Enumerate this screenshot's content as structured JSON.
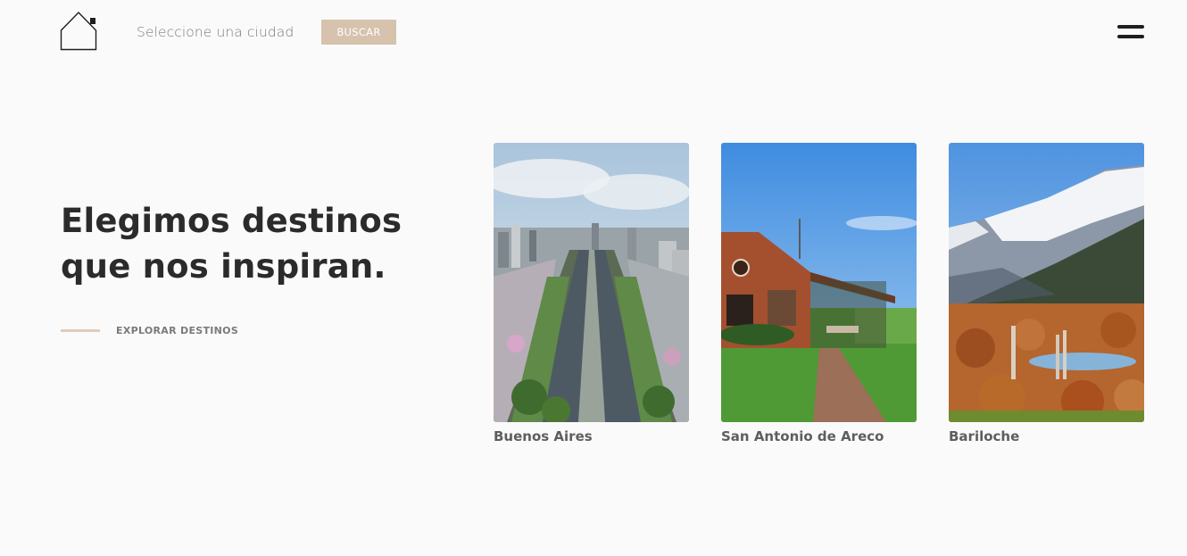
{
  "header": {
    "logo_icon": "house-outline-icon",
    "search": {
      "placeholder": "Seleccione una ciudad",
      "value": ""
    },
    "search_button_label": "BUSCAR",
    "menu_icon": "hamburger-menu-icon"
  },
  "hero": {
    "title_line1": "Elegimos destinos",
    "title_line2": "que nos inspiran.",
    "explore_label": "EXPLORAR DESTINOS"
  },
  "destinations": [
    {
      "name": "Buenos Aires",
      "image": "city-avenue-photo"
    },
    {
      "name": "San Antonio de Areco",
      "image": "country-farmhouse-photo"
    },
    {
      "name": "Bariloche",
      "image": "mountain-lake-photo"
    }
  ],
  "colors": {
    "background": "#fafafa",
    "accent": "#d6c2ad",
    "accent_line": "#e2cbb9",
    "title": "#2b2b2b",
    "muted_text": "#7a7a7a"
  }
}
